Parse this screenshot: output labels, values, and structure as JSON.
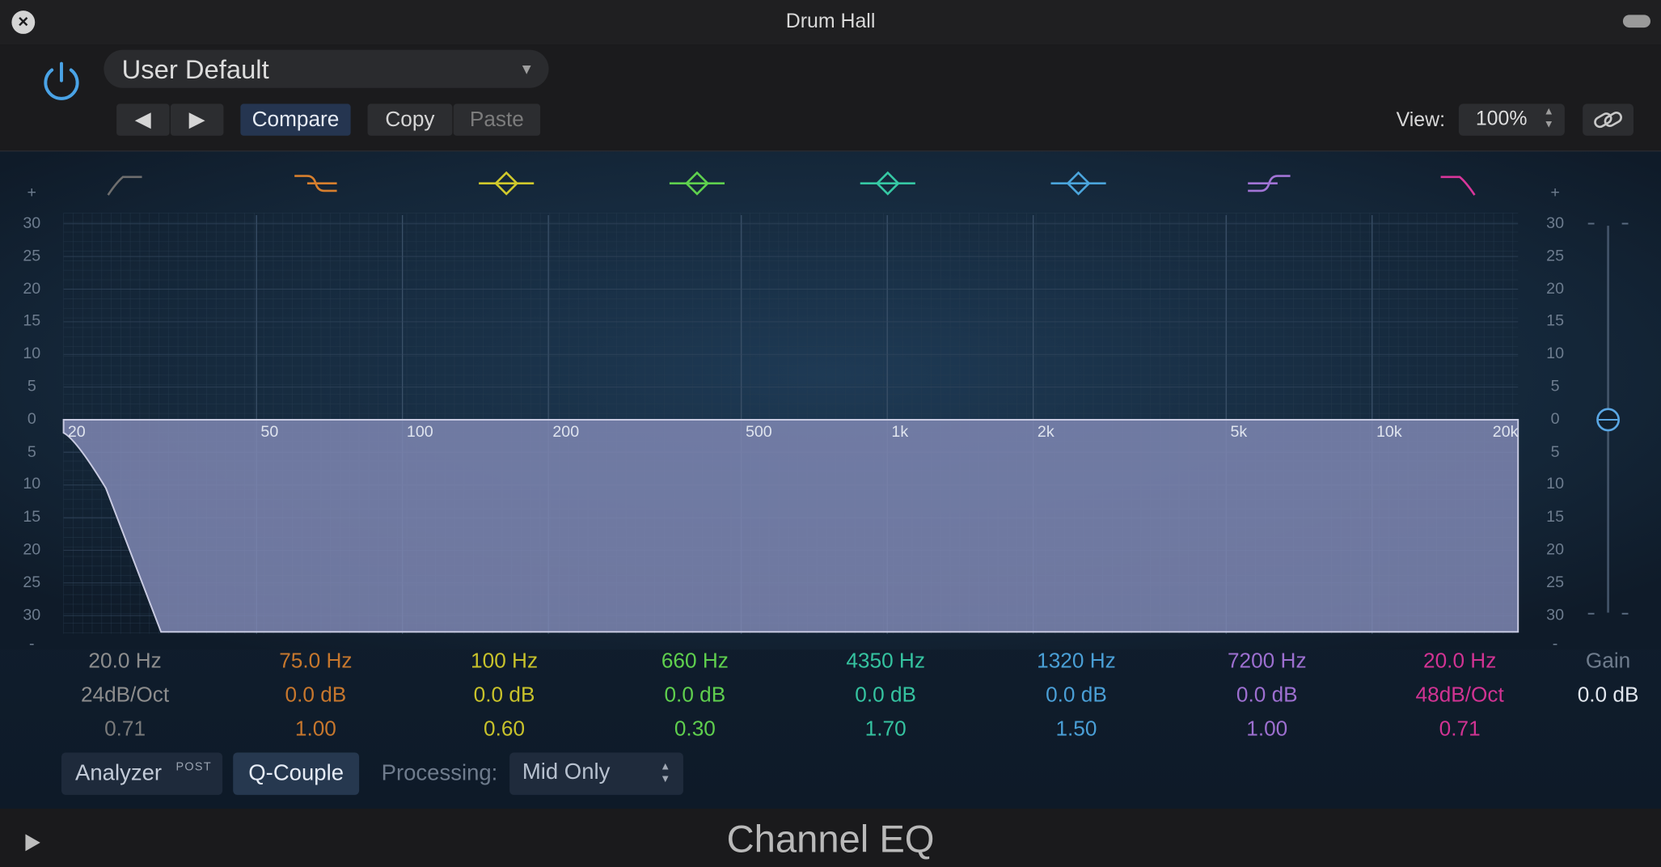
{
  "window": {
    "title": "Drum Hall"
  },
  "header": {
    "preset": "User Default",
    "prev_label": "◀",
    "next_label": "▶",
    "compare_label": "Compare",
    "copy_label": "Copy",
    "paste_label": "Paste",
    "view_label": "View:",
    "view_value": "100%"
  },
  "graph": {
    "db_left": [
      "+",
      "30",
      "25",
      "20",
      "15",
      "10",
      "5",
      "0",
      "5",
      "10",
      "15",
      "20",
      "25",
      "30",
      "-"
    ],
    "db_right": [
      "+",
      "30",
      "25",
      "20",
      "15",
      "10",
      "5",
      "0",
      "5",
      "10",
      "15",
      "20",
      "25",
      "30",
      "-"
    ],
    "freq_ticks": [
      "20",
      "50",
      "100",
      "200",
      "500",
      "1k",
      "2k",
      "5k",
      "10k",
      "20k"
    ]
  },
  "bands": [
    {
      "freq": "20.0 Hz",
      "gain": "24dB/Oct",
      "q": "0.71",
      "color": "#8d8d8d",
      "q_color": "#7a7a7a",
      "icon": "lowcut-icon"
    },
    {
      "freq": "75.0 Hz",
      "gain": "0.0 dB",
      "q": "1.00",
      "color": "#c7772d",
      "q_color": "#c7772d",
      "icon": "lowshelf-icon"
    },
    {
      "freq": "100 Hz",
      "gain": "0.0 dB",
      "q": "0.60",
      "color": "#c8c22b",
      "q_color": "#c8c22b",
      "icon": "bell-icon"
    },
    {
      "freq": "660 Hz",
      "gain": "0.0 dB",
      "q": "0.30",
      "color": "#5fcf4e",
      "q_color": "#5fcf4e",
      "icon": "bell-icon"
    },
    {
      "freq": "4350 Hz",
      "gain": "0.0 dB",
      "q": "1.70",
      "color": "#35c3a0",
      "q_color": "#35c3a0",
      "icon": "bell-icon"
    },
    {
      "freq": "1320 Hz",
      "gain": "0.0 dB",
      "q": "1.50",
      "color": "#4a9fd6",
      "q_color": "#4a9fd6",
      "icon": "bell-icon"
    },
    {
      "freq": "7200 Hz",
      "gain": "0.0 dB",
      "q": "1.00",
      "color": "#9d6fd0",
      "q_color": "#9d6fd0",
      "icon": "highshelf-icon"
    },
    {
      "freq": "20.0 Hz",
      "gain": "48dB/Oct",
      "q": "0.71",
      "color": "#d13393",
      "q_color": "#d13393",
      "icon": "highcut-icon"
    }
  ],
  "gain": {
    "label": "Gain",
    "value": "0.0 dB"
  },
  "bottom": {
    "analyzer_label": "Analyzer",
    "analyzer_badge": "POST",
    "qcouple_label": "Q-Couple",
    "processing_label": "Processing:",
    "processing_value": "Mid Only"
  },
  "footer": {
    "plugin_name": "Channel EQ"
  }
}
